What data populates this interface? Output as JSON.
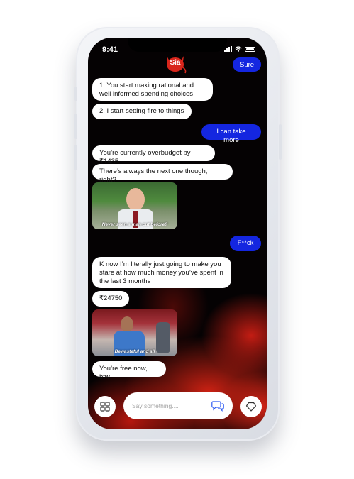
{
  "status": {
    "time": "9:41"
  },
  "logo": {
    "text": "Sia",
    "color": "#d9261c"
  },
  "colors": {
    "bot_bubble": "#ffffff",
    "user_bubble": "#1426e0",
    "accent_blue": "#2f5cf2"
  },
  "messages": [
    {
      "sender": "user",
      "text": "Sure"
    },
    {
      "sender": "bot",
      "text": "1. You start making rational and well informed spending choices"
    },
    {
      "sender": "bot",
      "text": "2. I start setting fire to things"
    },
    {
      "sender": "user",
      "text": "I can take more"
    },
    {
      "sender": "bot",
      "text": "You’re currently overbudget by ₹1435"
    },
    {
      "sender": "bot",
      "text": "There’s always the next one though, right?"
    },
    {
      "sender": "bot",
      "type": "gif",
      "caption": "Never seen a man cut before?"
    },
    {
      "sender": "user",
      "text": "F**ck"
    },
    {
      "sender": "bot",
      "text": "K now I’m literally just going to make you stare at how much money you’ve spent in the last 3 months"
    },
    {
      "sender": "bot",
      "text": "₹24750"
    },
    {
      "sender": "bot",
      "type": "gif",
      "caption": "Bewasteful and all"
    },
    {
      "sender": "bot",
      "text": "You’re free now, btw"
    }
  ],
  "composer": {
    "placeholder": "Say something...."
  },
  "icons": {
    "left": "grid-icon",
    "send": "chat-bubbles-icon",
    "right": "heart-icon"
  }
}
